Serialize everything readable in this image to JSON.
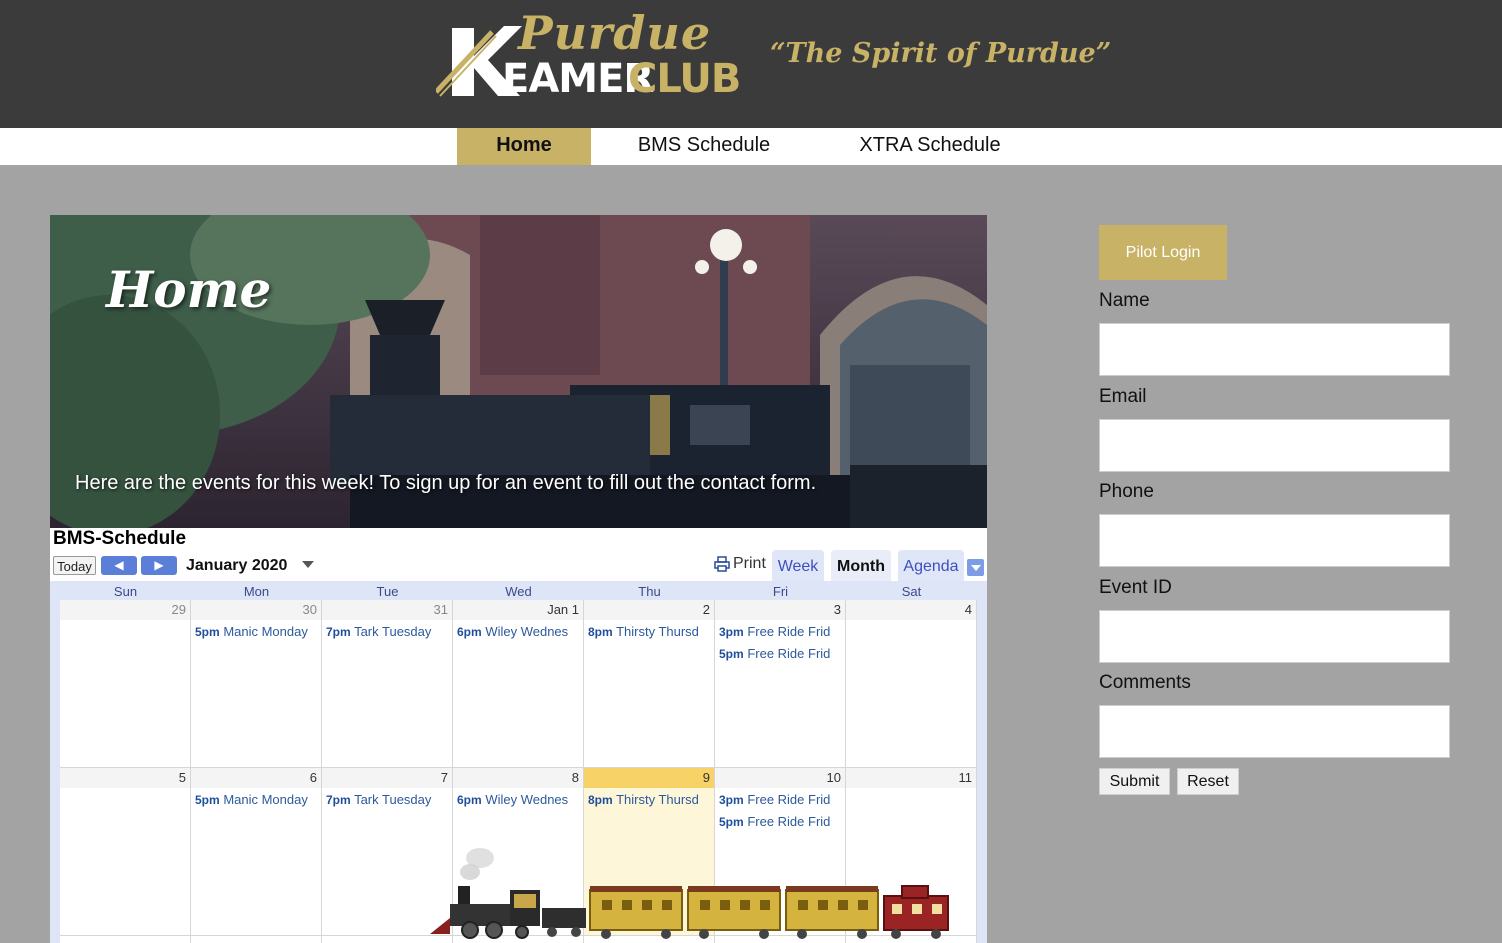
{
  "header": {
    "logo_purdue": "Purdue",
    "logo_eamer": "EAMER",
    "logo_club": "CLUB",
    "tagline": "“The Spirit of Purdue”",
    "accent_color": "#c8b266"
  },
  "nav": {
    "items": [
      {
        "label": "Home",
        "active": true
      },
      {
        "label": "BMS Schedule",
        "active": false
      },
      {
        "label": "XTRA Schedule",
        "active": false
      }
    ]
  },
  "hero": {
    "title": "Home",
    "caption": "Here are the events for this week! To sign up for an event to fill out the contact form."
  },
  "calendar": {
    "title": "BMS-Schedule",
    "today_label": "Today",
    "prev_icon": "prev-arrow-icon",
    "next_icon": "next-arrow-icon",
    "month_label": "January 2020",
    "print_label": "Print",
    "views": [
      "Week",
      "Month",
      "Agenda"
    ],
    "active_view": "Month",
    "days_of_week": [
      "Sun",
      "Mon",
      "Tue",
      "Wed",
      "Thu",
      "Fri",
      "Sat"
    ],
    "weeks": [
      {
        "days": [
          {
            "num": "29",
            "other": true,
            "today": false,
            "events": []
          },
          {
            "num": "30",
            "other": true,
            "today": false,
            "events": [
              {
                "time": "5pm",
                "title": "Manic Monday"
              }
            ]
          },
          {
            "num": "31",
            "other": true,
            "today": false,
            "events": [
              {
                "time": "7pm",
                "title": "Tark Tuesday"
              }
            ]
          },
          {
            "num": "Jan 1",
            "other": false,
            "today": false,
            "events": [
              {
                "time": "6pm",
                "title": "Wiley Wednes"
              }
            ]
          },
          {
            "num": "2",
            "other": false,
            "today": false,
            "events": [
              {
                "time": "8pm",
                "title": "Thirsty Thursd"
              }
            ]
          },
          {
            "num": "3",
            "other": false,
            "today": false,
            "events": [
              {
                "time": "3pm",
                "title": "Free Ride Frid"
              },
              {
                "time": "5pm",
                "title": "Free Ride Frid"
              }
            ]
          },
          {
            "num": "4",
            "other": false,
            "today": false,
            "events": []
          }
        ]
      },
      {
        "days": [
          {
            "num": "5",
            "other": false,
            "today": false,
            "events": []
          },
          {
            "num": "6",
            "other": false,
            "today": false,
            "events": [
              {
                "time": "5pm",
                "title": "Manic Monday"
              }
            ]
          },
          {
            "num": "7",
            "other": false,
            "today": false,
            "events": [
              {
                "time": "7pm",
                "title": "Tark Tuesday"
              }
            ]
          },
          {
            "num": "8",
            "other": false,
            "today": false,
            "events": [
              {
                "time": "6pm",
                "title": "Wiley Wednes"
              }
            ]
          },
          {
            "num": "9",
            "other": false,
            "today": true,
            "events": [
              {
                "time": "8pm",
                "title": "Thirsty Thursd"
              }
            ]
          },
          {
            "num": "10",
            "other": false,
            "today": false,
            "events": [
              {
                "time": "3pm",
                "title": "Free Ride Frid"
              },
              {
                "time": "5pm",
                "title": "Free Ride Frid"
              }
            ]
          },
          {
            "num": "11",
            "other": false,
            "today": false,
            "events": []
          }
        ]
      }
    ]
  },
  "sidebar": {
    "login_label": "Pilot Login",
    "fields": [
      {
        "label": "Name",
        "value": ""
      },
      {
        "label": "Email",
        "value": ""
      },
      {
        "label": "Phone",
        "value": ""
      },
      {
        "label": "Event ID",
        "value": ""
      },
      {
        "label": "Comments",
        "value": ""
      }
    ],
    "submit_label": "Submit",
    "reset_label": "Reset"
  }
}
